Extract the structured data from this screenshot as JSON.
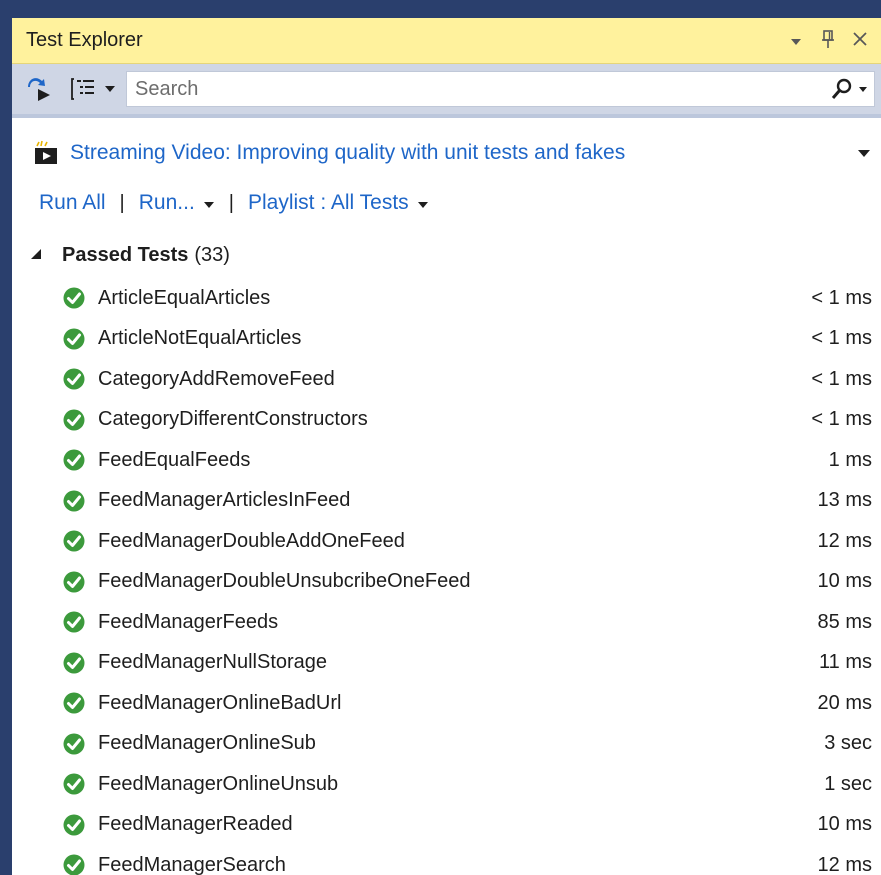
{
  "window": {
    "title": "Test Explorer"
  },
  "toolbar": {
    "search_placeholder": "Search"
  },
  "video": {
    "link_text": "Streaming Video: Improving quality with unit tests and fakes"
  },
  "commands": {
    "run_all": "Run All",
    "run": "Run...",
    "playlist": "Playlist : All Tests"
  },
  "group": {
    "name": "Passed Tests",
    "count": "(33)"
  },
  "colors": {
    "accent_link": "#1e66c8",
    "title_bar": "#fff29d",
    "pass_green": "#3c9a3c"
  },
  "tests": [
    {
      "name": "ArticleEqualArticles",
      "time": "< 1 ms"
    },
    {
      "name": "ArticleNotEqualArticles",
      "time": "< 1 ms"
    },
    {
      "name": "CategoryAddRemoveFeed",
      "time": "< 1 ms"
    },
    {
      "name": "CategoryDifferentConstructors",
      "time": "< 1 ms"
    },
    {
      "name": "FeedEqualFeeds",
      "time": "1 ms"
    },
    {
      "name": "FeedManagerArticlesInFeed",
      "time": "13 ms"
    },
    {
      "name": "FeedManagerDoubleAddOneFeed",
      "time": "12 ms"
    },
    {
      "name": "FeedManagerDoubleUnsubcribeOneFeed",
      "time": "10 ms"
    },
    {
      "name": "FeedManagerFeeds",
      "time": "85 ms"
    },
    {
      "name": "FeedManagerNullStorage",
      "time": "11 ms"
    },
    {
      "name": "FeedManagerOnlineBadUrl",
      "time": "20 ms"
    },
    {
      "name": "FeedManagerOnlineSub",
      "time": "3 sec"
    },
    {
      "name": "FeedManagerOnlineUnsub",
      "time": "1 sec"
    },
    {
      "name": "FeedManagerReaded",
      "time": "10 ms"
    },
    {
      "name": "FeedManagerSearch",
      "time": "12 ms"
    }
  ]
}
